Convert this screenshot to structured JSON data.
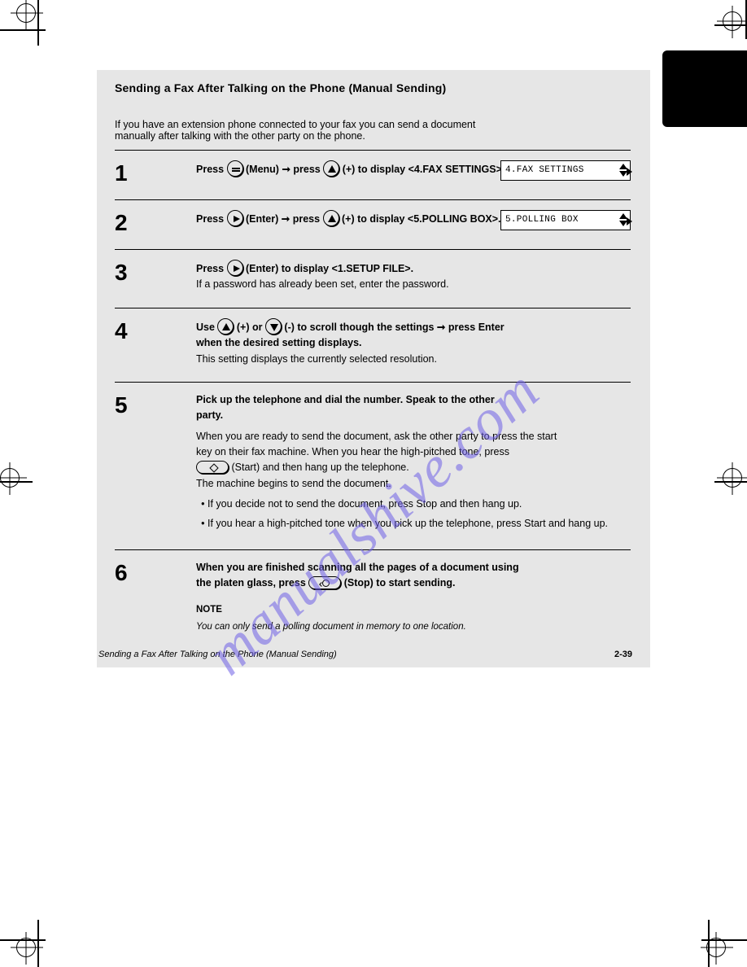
{
  "watermark": "manualshive.com",
  "panel": {
    "title": "Sending a Fax After Talking on the Phone (Manual Sending)",
    "intro": "If you have an extension phone connected to your fax you can send a document\nmanually after talking with the other party on the phone.",
    "steps": [
      {
        "num": "1",
        "main": "Press          (Menu) ➞ press         (+) to display <4.FAX SETTINGS>.",
        "lcd": "4.FAX SETTINGS"
      },
      {
        "num": "2",
        "main": "Press          (Enter) ➞ press         (+) to display <5.POLLING BOX>.",
        "lcd": "5.POLLING BOX"
      },
      {
        "num": "3",
        "lines": [
          "Press          (Enter) to display <1.SETUP FILE>.",
          "If a password has already been set, enter the password."
        ]
      },
      {
        "num": "4",
        "lines": [
          "Use         (+) or         (-) to scroll though the settings ➞ press Enter",
          "when the desired setting displays.",
          "This setting displays the currently selected resolution."
        ]
      },
      {
        "num": "5",
        "main": "Pick up the telephone and dial the number. Speak to the other\nparty.",
        "sub_pre": "When you are ready to send the document, ask the other party to press the start\nkey on their fax machine. When you hear the high-pitched tone, press\n",
        "sub_post": " (Start) and then hang up the telephone.\nThe machine begins to send the document.",
        "list": [
          "If you decide not to send the document, press Stop and then hang up.",
          "If you hear a high-pitched tone when you pick up the telephone, press Start and hang up."
        ]
      },
      {
        "num": "6",
        "main": "When you are finished scanning all the pages of a document using\nthe platen glass, press                  (Stop) to start sending.",
        "note_title": "NOTE",
        "note_body": "You can only send a polling document in memory to one location."
      }
    ],
    "footer_left": "Sending a Fax After Talking on the Phone (Manual Sending)",
    "footer_right": "2-39"
  }
}
